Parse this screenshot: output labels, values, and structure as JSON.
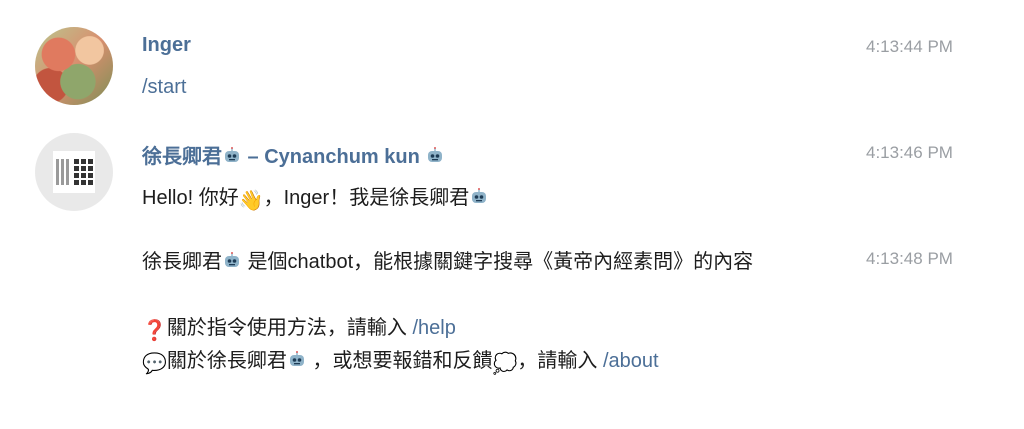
{
  "messages": [
    {
      "sender": "Inger",
      "time": "4:13:44 PM",
      "text": "/start"
    },
    {
      "sender_name": "徐長卿君",
      "sender_suffix": " – Cynanchum kun ",
      "time": "4:13:46 PM",
      "greeting_pre": "Hello! 你好",
      "greeting_mid": "，Inger！我是徐長卿君",
      "reply2": {
        "time": "4:13:48 PM",
        "line1_name": "徐長卿君",
        "line1_text": " 是個chatbot，能根據關鍵字搜尋《黃帝內經素問》的內容",
        "line2_text": "關於指令使用方法，請輸入 ",
        "line2_cmd": "/help",
        "line3_text_a": "關於徐長卿君",
        "line3_text_b": " ，或想要報錯和反饋",
        "line3_text_c": "，請輸入 ",
        "line3_cmd": "/about"
      }
    }
  ],
  "icons": {
    "robot": "robot-emoji-icon",
    "wave": "waving-hand-emoji-icon",
    "question": "red-question-mark-icon",
    "speech": "speech-balloon-icon",
    "thought": "thought-balloon-icon"
  },
  "colors": {
    "sender": "#4c6f97",
    "link": "#4c6f97",
    "time": "#9a9ea3",
    "text": "#1d1d1d"
  }
}
